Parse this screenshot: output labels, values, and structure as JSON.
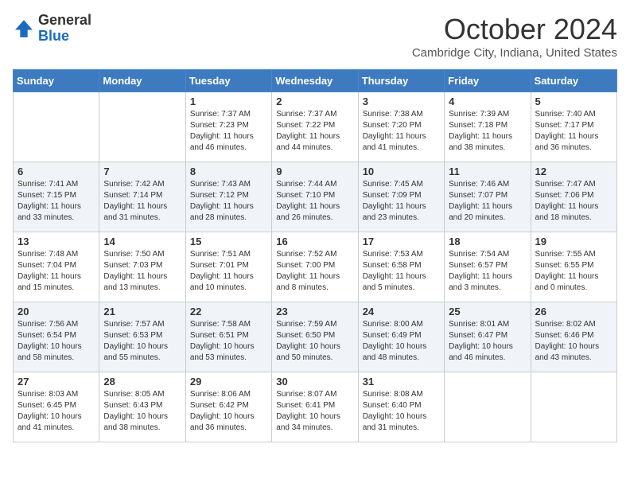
{
  "header": {
    "logo_line1": "General",
    "logo_line2": "Blue",
    "month": "October 2024",
    "location": "Cambridge City, Indiana, United States"
  },
  "days_of_week": [
    "Sunday",
    "Monday",
    "Tuesday",
    "Wednesday",
    "Thursday",
    "Friday",
    "Saturday"
  ],
  "weeks": [
    [
      {
        "day": "",
        "info": ""
      },
      {
        "day": "",
        "info": ""
      },
      {
        "day": "1",
        "info": "Sunrise: 7:37 AM\nSunset: 7:23 PM\nDaylight: 11 hours and 46 minutes."
      },
      {
        "day": "2",
        "info": "Sunrise: 7:37 AM\nSunset: 7:22 PM\nDaylight: 11 hours and 44 minutes."
      },
      {
        "day": "3",
        "info": "Sunrise: 7:38 AM\nSunset: 7:20 PM\nDaylight: 11 hours and 41 minutes."
      },
      {
        "day": "4",
        "info": "Sunrise: 7:39 AM\nSunset: 7:18 PM\nDaylight: 11 hours and 38 minutes."
      },
      {
        "day": "5",
        "info": "Sunrise: 7:40 AM\nSunset: 7:17 PM\nDaylight: 11 hours and 36 minutes."
      }
    ],
    [
      {
        "day": "6",
        "info": "Sunrise: 7:41 AM\nSunset: 7:15 PM\nDaylight: 11 hours and 33 minutes."
      },
      {
        "day": "7",
        "info": "Sunrise: 7:42 AM\nSunset: 7:14 PM\nDaylight: 11 hours and 31 minutes."
      },
      {
        "day": "8",
        "info": "Sunrise: 7:43 AM\nSunset: 7:12 PM\nDaylight: 11 hours and 28 minutes."
      },
      {
        "day": "9",
        "info": "Sunrise: 7:44 AM\nSunset: 7:10 PM\nDaylight: 11 hours and 26 minutes."
      },
      {
        "day": "10",
        "info": "Sunrise: 7:45 AM\nSunset: 7:09 PM\nDaylight: 11 hours and 23 minutes."
      },
      {
        "day": "11",
        "info": "Sunrise: 7:46 AM\nSunset: 7:07 PM\nDaylight: 11 hours and 20 minutes."
      },
      {
        "day": "12",
        "info": "Sunrise: 7:47 AM\nSunset: 7:06 PM\nDaylight: 11 hours and 18 minutes."
      }
    ],
    [
      {
        "day": "13",
        "info": "Sunrise: 7:48 AM\nSunset: 7:04 PM\nDaylight: 11 hours and 15 minutes."
      },
      {
        "day": "14",
        "info": "Sunrise: 7:50 AM\nSunset: 7:03 PM\nDaylight: 11 hours and 13 minutes."
      },
      {
        "day": "15",
        "info": "Sunrise: 7:51 AM\nSunset: 7:01 PM\nDaylight: 11 hours and 10 minutes."
      },
      {
        "day": "16",
        "info": "Sunrise: 7:52 AM\nSunset: 7:00 PM\nDaylight: 11 hours and 8 minutes."
      },
      {
        "day": "17",
        "info": "Sunrise: 7:53 AM\nSunset: 6:58 PM\nDaylight: 11 hours and 5 minutes."
      },
      {
        "day": "18",
        "info": "Sunrise: 7:54 AM\nSunset: 6:57 PM\nDaylight: 11 hours and 3 minutes."
      },
      {
        "day": "19",
        "info": "Sunrise: 7:55 AM\nSunset: 6:55 PM\nDaylight: 11 hours and 0 minutes."
      }
    ],
    [
      {
        "day": "20",
        "info": "Sunrise: 7:56 AM\nSunset: 6:54 PM\nDaylight: 10 hours and 58 minutes."
      },
      {
        "day": "21",
        "info": "Sunrise: 7:57 AM\nSunset: 6:53 PM\nDaylight: 10 hours and 55 minutes."
      },
      {
        "day": "22",
        "info": "Sunrise: 7:58 AM\nSunset: 6:51 PM\nDaylight: 10 hours and 53 minutes."
      },
      {
        "day": "23",
        "info": "Sunrise: 7:59 AM\nSunset: 6:50 PM\nDaylight: 10 hours and 50 minutes."
      },
      {
        "day": "24",
        "info": "Sunrise: 8:00 AM\nSunset: 6:49 PM\nDaylight: 10 hours and 48 minutes."
      },
      {
        "day": "25",
        "info": "Sunrise: 8:01 AM\nSunset: 6:47 PM\nDaylight: 10 hours and 46 minutes."
      },
      {
        "day": "26",
        "info": "Sunrise: 8:02 AM\nSunset: 6:46 PM\nDaylight: 10 hours and 43 minutes."
      }
    ],
    [
      {
        "day": "27",
        "info": "Sunrise: 8:03 AM\nSunset: 6:45 PM\nDaylight: 10 hours and 41 minutes."
      },
      {
        "day": "28",
        "info": "Sunrise: 8:05 AM\nSunset: 6:43 PM\nDaylight: 10 hours and 38 minutes."
      },
      {
        "day": "29",
        "info": "Sunrise: 8:06 AM\nSunset: 6:42 PM\nDaylight: 10 hours and 36 minutes."
      },
      {
        "day": "30",
        "info": "Sunrise: 8:07 AM\nSunset: 6:41 PM\nDaylight: 10 hours and 34 minutes."
      },
      {
        "day": "31",
        "info": "Sunrise: 8:08 AM\nSunset: 6:40 PM\nDaylight: 10 hours and 31 minutes."
      },
      {
        "day": "",
        "info": ""
      },
      {
        "day": "",
        "info": ""
      }
    ]
  ]
}
